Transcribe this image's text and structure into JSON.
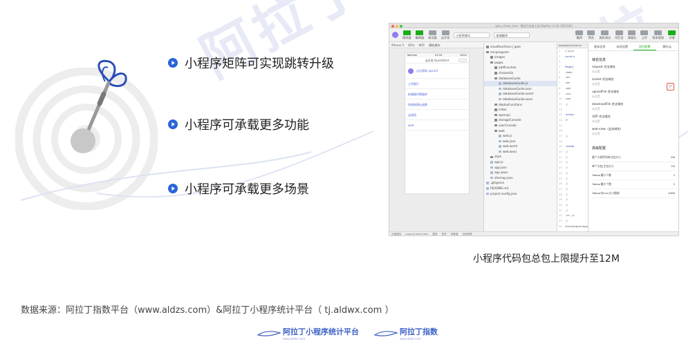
{
  "brand": {
    "watermark": "阿拉丁",
    "accent": "#2a64d8",
    "footer_logo_1": "阿拉丁小程序统计平台",
    "footer_logo_1_sub": "www.aldwx.com",
    "footer_logo_2": "阿拉丁指数",
    "footer_logo_2_sub": "www.aldzs.com"
  },
  "hero_icon": "dart-in-target-icon",
  "bullets": [
    {
      "text": "小程序矩阵可实现跳转升级"
    },
    {
      "text": "小程序可承载更多功能"
    },
    {
      "text": "小程序可承载更多场景"
    }
  ],
  "screenshot": {
    "window_title": "gaia_clover_test - 微信开发者工具 Nightly v1.02.1901083",
    "toolbar": {
      "left_buttons": [
        "模拟器",
        "编辑器",
        "调试器",
        "云开发"
      ],
      "mode_select": "小程序模式",
      "compile_select": "普通编译",
      "right_buttons": [
        "编译",
        "预览",
        "真机调试",
        "切后台",
        "清缓存",
        "上传",
        "版本管理",
        "详情"
      ]
    },
    "sim_bar": [
      "iPhone 5",
      "85%",
      "WiFi",
      "模拟操作"
    ],
    "phone": {
      "carrier": "WeChat",
      "time": "15:16",
      "battery": "100%",
      "nav_title": "云开发 QuickStart",
      "hero_label": "点击获取 openid",
      "rows": [
        "上传图片",
        "前端操作数据库",
        "快速新建云函数",
        "云调用",
        "web"
      ]
    },
    "tree": [
      {
        "name": "cloudfunctions | gaia",
        "type": "folder",
        "depth": 0
      },
      {
        "name": "miniprogram",
        "type": "folder",
        "depth": 0
      },
      {
        "name": "images",
        "type": "folder",
        "depth": 1
      },
      {
        "name": "pages",
        "type": "folder",
        "depth": 1
      },
      {
        "name": "addFunction",
        "type": "folder",
        "depth": 2
      },
      {
        "name": "chooseLib",
        "type": "folder",
        "depth": 2
      },
      {
        "name": "databaseGuide",
        "type": "folder",
        "depth": 2
      },
      {
        "name": "databaseGuide.js",
        "type": "file",
        "depth": 3,
        "selected": true
      },
      {
        "name": "databaseGuide.json",
        "type": "file",
        "depth": 3
      },
      {
        "name": "databaseGuide.wxml",
        "type": "file",
        "depth": 3
      },
      {
        "name": "databaseGuide.wxss",
        "type": "file",
        "depth": 3
      },
      {
        "name": "deployFunctions",
        "type": "folder",
        "depth": 2
      },
      {
        "name": "index",
        "type": "folder",
        "depth": 2
      },
      {
        "name": "openapi",
        "type": "folder",
        "depth": 2
      },
      {
        "name": "storageConsole",
        "type": "folder",
        "depth": 2
      },
      {
        "name": "userConsole",
        "type": "folder",
        "depth": 2
      },
      {
        "name": "web",
        "type": "folder",
        "depth": 2
      },
      {
        "name": "web.js",
        "type": "file",
        "depth": 3
      },
      {
        "name": "web.json",
        "type": "file",
        "depth": 3
      },
      {
        "name": "web.wxml",
        "type": "file",
        "depth": 3
      },
      {
        "name": "web.wxss",
        "type": "file",
        "depth": 3
      },
      {
        "name": "style",
        "type": "folder",
        "depth": 1
      },
      {
        "name": "app.js",
        "type": "file",
        "depth": 1
      },
      {
        "name": "app.json",
        "type": "file",
        "depth": 1
      },
      {
        "name": "app.wxss",
        "type": "file",
        "depth": 1
      },
      {
        "name": "sitemap.json",
        "type": "file",
        "depth": 1
      },
      {
        "name": ".gitignore",
        "type": "file",
        "depth": 0
      },
      {
        "name": "README.md",
        "type": "file",
        "depth": 0
      },
      {
        "name": "project.config.json",
        "type": "file",
        "depth": 0
      }
    ],
    "code": {
      "tab": "databaseGuide.js",
      "lines": [
        {
          "n": "1",
          "t": "// page",
          "cls": "c"
        },
        {
          "n": "2",
          "t": "const a",
          "cls": "k"
        },
        {
          "n": "3",
          "t": "",
          "cls": ""
        },
        {
          "n": "4",
          "t": "Page({",
          "cls": "k"
        },
        {
          "n": "5",
          "t": "  data:",
          "cls": ""
        },
        {
          "n": "6",
          "t": "    ste",
          "cls": ""
        },
        {
          "n": "7",
          "t": "    ste",
          "cls": ""
        },
        {
          "n": "8",
          "t": "    ope",
          "cls": ""
        },
        {
          "n": "9",
          "t": "    cou",
          "cls": ""
        },
        {
          "n": "10",
          "t": "    que",
          "cls": ""
        },
        {
          "n": "11",
          "t": "  },",
          "cls": ""
        },
        {
          "n": "12",
          "t": "",
          "cls": ""
        },
        {
          "n": "13",
          "t": "  onLoa",
          "cls": "k"
        },
        {
          "n": "14",
          "t": "    if",
          "cls": ""
        },
        {
          "n": "15",
          "t": "",
          "cls": ""
        },
        {
          "n": "16",
          "t": "",
          "cls": ""
        },
        {
          "n": "17",
          "t": "  }",
          "cls": ""
        },
        {
          "n": "18",
          "t": "",
          "cls": ""
        },
        {
          "n": "19",
          "t": "  onAdd",
          "cls": "k"
        },
        {
          "n": "20",
          "t": "    //",
          "cls": "c"
        },
        {
          "n": "21",
          "t": "    //",
          "cls": "c"
        },
        {
          "n": "22",
          "t": "    //",
          "cls": "c"
        },
        {
          "n": "23",
          "t": "    //",
          "cls": "c"
        },
        {
          "n": "24",
          "t": "    //",
          "cls": "c"
        },
        {
          "n": "25",
          "t": "    //",
          "cls": "c"
        },
        {
          "n": "26",
          "t": "    //",
          "cls": "c"
        },
        {
          "n": "27",
          "t": "    //",
          "cls": "c"
        },
        {
          "n": "28",
          "t": "    //",
          "cls": "c"
        },
        {
          "n": "29",
          "t": "    //",
          "cls": "c"
        },
        {
          "n": "30",
          "t": "    //",
          "cls": "c"
        },
        {
          "n": "31",
          "t": "    //",
          "cls": "c"
        },
        {
          "n": "32",
          "t": "    res._id",
          "cls": "c"
        },
        {
          "n": "33",
          "t": "    //",
          "cls": "c"
        },
        {
          "n": "34",
          "t": "/miniprogram/page",
          "cls": ""
        }
      ]
    },
    "detail": {
      "tabs": [
        "基本信息",
        "本地设置",
        "项目配置",
        "腾讯云"
      ],
      "active_tab": 2,
      "domain_title": "域名信息",
      "domains": [
        {
          "k": "request 合法域名",
          "v": "未设置"
        },
        {
          "k": "socket 合法域名",
          "v": "未设置"
        },
        {
          "k": "uploadFile 合法域名",
          "v": "未设置"
        },
        {
          "k": "downloadFile 合法域名",
          "v": "未设置"
        },
        {
          "k": "UDP 合法域名",
          "v": "未设置"
        },
        {
          "k": "web-view（业务域名）",
          "v": "未设置"
        }
      ],
      "advanced_title": "高级配置",
      "advanced": [
        {
          "k": "整个小程序所有分包大小",
          "v": "8M"
        },
        {
          "k": "单个分包/主包大小",
          "v": "2M"
        },
        {
          "k": "Tabbar最小个数",
          "v": "2"
        },
        {
          "k": "Tabbar最大个数",
          "v": "5"
        },
        {
          "k": "Tabbar的icon大小限制",
          "v": "40KB"
        }
      ]
    },
    "statusbar": [
      "页面路径",
      "pages/index/index",
      "复制",
      "预览",
      "场景值",
      "页面参数"
    ]
  },
  "caption": "小程序代码包总包上限提升至12M",
  "source": "数据来源：阿拉丁指数平台（www.aldzs.com）&阿拉丁小程序统计平台（ tj.aldwx.com ）"
}
